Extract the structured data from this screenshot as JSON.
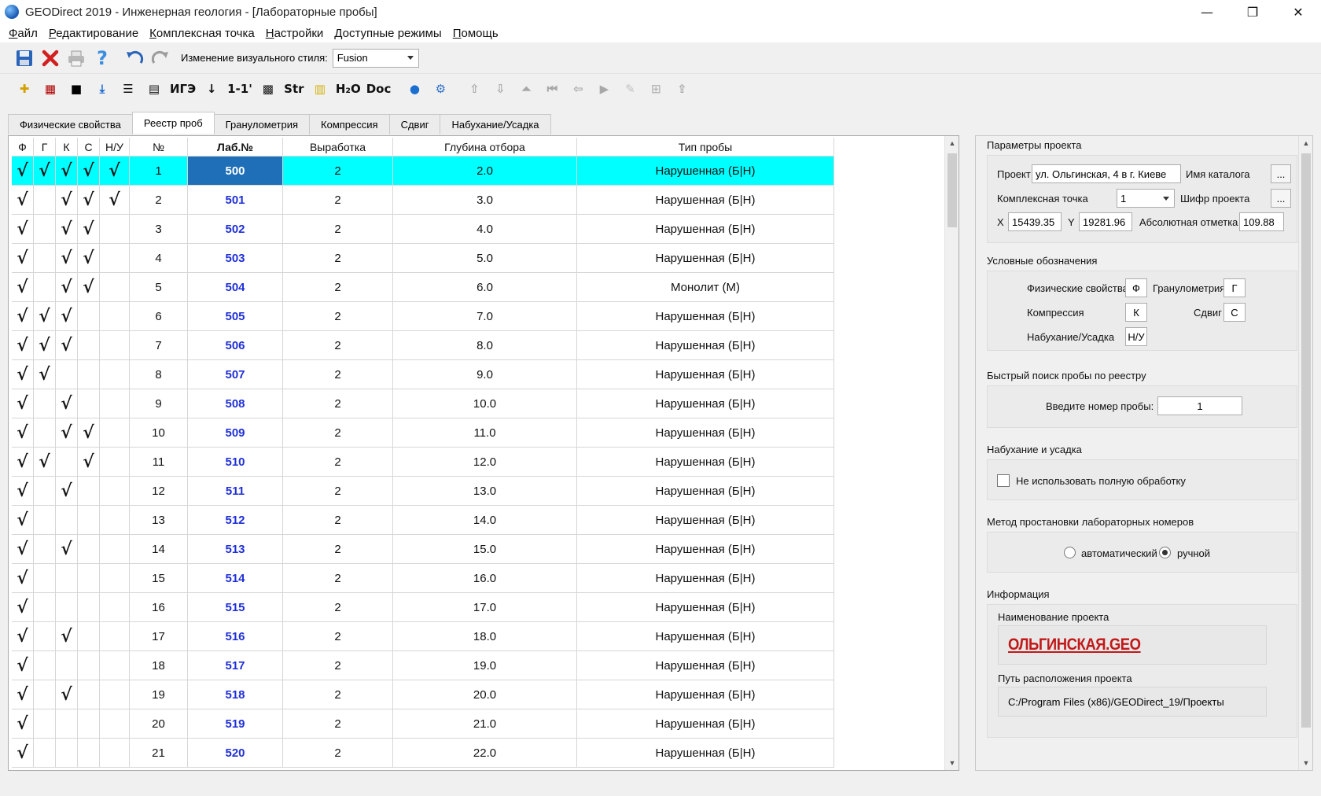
{
  "window": {
    "title": "GEODirect 2019 - Инженерная геология - [Лабораторные пробы]",
    "minimize": "—",
    "restore": "❐",
    "close": "✕"
  },
  "menu": [
    "Файл",
    "Редактирование",
    "Комплексная точка",
    "Настройки",
    "Доступные режимы",
    "Помощь"
  ],
  "toolbar1": {
    "style_label": "Изменение визуального стиля:",
    "style_value": "Fusion",
    "icons": [
      "save-icon",
      "delete-icon",
      "print-icon",
      "help-icon",
      "undo-icon",
      "redo-icon"
    ]
  },
  "toolbar2": {
    "items": [
      {
        "name": "crosshair-icon",
        "text": "✚",
        "color": "#d4a000"
      },
      {
        "name": "hatch-icon",
        "text": "▦",
        "color": "#b00000"
      },
      {
        "name": "black-square-icon",
        "text": "■",
        "color": "#000000"
      },
      {
        "name": "download-icon",
        "text": "⤓",
        "color": "#1060d0"
      },
      {
        "name": "lines-icon",
        "text": "☰",
        "color": "#111111"
      },
      {
        "name": "list-icon",
        "text": "▤",
        "color": "#111111"
      },
      {
        "name": "igz-button",
        "text": "ИГЭ",
        "color": "#111111"
      },
      {
        "name": "arrow-down-icon",
        "text": "↓",
        "color": "#111111"
      },
      {
        "name": "section-button",
        "text": "1-1'",
        "color": "#111111"
      },
      {
        "name": "grid-icon",
        "text": "▩",
        "color": "#111111"
      },
      {
        "name": "str-button",
        "text": "Str",
        "color": "#111111"
      },
      {
        "name": "ruler-icon",
        "text": "▥",
        "color": "#d4b000"
      },
      {
        "name": "h2o-button",
        "text": "H₂O",
        "color": "#111111"
      },
      {
        "name": "doc-button",
        "text": "Doc",
        "color": "#111111"
      },
      {
        "name": "globe-icon",
        "text": "●",
        "color": "#1a6fd0"
      },
      {
        "name": "settings-icon",
        "text": "⚙",
        "color": "#2a70c8"
      },
      {
        "name": "move-up-icon",
        "text": "⇧",
        "color": "#a8a8a8"
      },
      {
        "name": "move-down-icon",
        "text": "⇩",
        "color": "#a8a8a8"
      },
      {
        "name": "move-top-icon",
        "text": "⏶",
        "color": "#a8a8a8"
      },
      {
        "name": "move-first-icon",
        "text": "⏮",
        "color": "#a8a8a8"
      },
      {
        "name": "move-left-icon",
        "text": "⇦",
        "color": "#a8a8a8"
      },
      {
        "name": "play-icon",
        "text": "▶",
        "color": "#a8a8a8"
      },
      {
        "name": "pencil-icon",
        "text": "✎",
        "color": "#c0c0c0"
      },
      {
        "name": "tree-icon",
        "text": "⊞",
        "color": "#b8b8b8"
      },
      {
        "name": "upload-icon",
        "text": "⇪",
        "color": "#a8a8a8"
      }
    ]
  },
  "tabs": [
    {
      "label": "Физические свойства",
      "active": false
    },
    {
      "label": "Реестр проб",
      "active": true
    },
    {
      "label": "Гранулометрия",
      "active": false
    },
    {
      "label": "Компрессия",
      "active": false
    },
    {
      "label": "Сдвиг",
      "active": false
    },
    {
      "label": "Набухание/Усадка",
      "active": false
    }
  ],
  "table": {
    "headers": [
      "Ф",
      "Г",
      "К",
      "С",
      "Н/У",
      "№",
      "Лаб.№",
      "Выработка",
      "Глубина отбора",
      "Тип пробы"
    ],
    "check_glyph": "√",
    "rows": [
      {
        "f": true,
        "g": true,
        "k": true,
        "s": true,
        "nu": true,
        "n": "1",
        "lab": "500",
        "work": "2",
        "depth": "2.0",
        "type": "Нарушенная (Б|Н)",
        "selected": true
      },
      {
        "f": true,
        "g": false,
        "k": true,
        "s": true,
        "nu": true,
        "n": "2",
        "lab": "501",
        "work": "2",
        "depth": "3.0",
        "type": "Нарушенная (Б|Н)"
      },
      {
        "f": true,
        "g": false,
        "k": true,
        "s": true,
        "nu": false,
        "n": "3",
        "lab": "502",
        "work": "2",
        "depth": "4.0",
        "type": "Нарушенная (Б|Н)"
      },
      {
        "f": true,
        "g": false,
        "k": true,
        "s": true,
        "nu": false,
        "n": "4",
        "lab": "503",
        "work": "2",
        "depth": "5.0",
        "type": "Нарушенная (Б|Н)"
      },
      {
        "f": true,
        "g": false,
        "k": true,
        "s": true,
        "nu": false,
        "n": "5",
        "lab": "504",
        "work": "2",
        "depth": "6.0",
        "type": "Монолит (М)"
      },
      {
        "f": true,
        "g": true,
        "k": true,
        "s": false,
        "nu": false,
        "n": "6",
        "lab": "505",
        "work": "2",
        "depth": "7.0",
        "type": "Нарушенная (Б|Н)"
      },
      {
        "f": true,
        "g": true,
        "k": true,
        "s": false,
        "nu": false,
        "n": "7",
        "lab": "506",
        "work": "2",
        "depth": "8.0",
        "type": "Нарушенная (Б|Н)"
      },
      {
        "f": true,
        "g": true,
        "k": false,
        "s": false,
        "nu": false,
        "n": "8",
        "lab": "507",
        "work": "2",
        "depth": "9.0",
        "type": "Нарушенная (Б|Н)"
      },
      {
        "f": true,
        "g": false,
        "k": true,
        "s": false,
        "nu": false,
        "n": "9",
        "lab": "508",
        "work": "2",
        "depth": "10.0",
        "type": "Нарушенная (Б|Н)"
      },
      {
        "f": true,
        "g": false,
        "k": true,
        "s": true,
        "nu": false,
        "n": "10",
        "lab": "509",
        "work": "2",
        "depth": "11.0",
        "type": "Нарушенная (Б|Н)"
      },
      {
        "f": true,
        "g": true,
        "k": false,
        "s": true,
        "nu": false,
        "n": "11",
        "lab": "510",
        "work": "2",
        "depth": "12.0",
        "type": "Нарушенная (Б|Н)"
      },
      {
        "f": true,
        "g": false,
        "k": true,
        "s": false,
        "nu": false,
        "n": "12",
        "lab": "511",
        "work": "2",
        "depth": "13.0",
        "type": "Нарушенная (Б|Н)"
      },
      {
        "f": true,
        "g": false,
        "k": false,
        "s": false,
        "nu": false,
        "n": "13",
        "lab": "512",
        "work": "2",
        "depth": "14.0",
        "type": "Нарушенная (Б|Н)"
      },
      {
        "f": true,
        "g": false,
        "k": true,
        "s": false,
        "nu": false,
        "n": "14",
        "lab": "513",
        "work": "2",
        "depth": "15.0",
        "type": "Нарушенная (Б|Н)"
      },
      {
        "f": true,
        "g": false,
        "k": false,
        "s": false,
        "nu": false,
        "n": "15",
        "lab": "514",
        "work": "2",
        "depth": "16.0",
        "type": "Нарушенная (Б|Н)"
      },
      {
        "f": true,
        "g": false,
        "k": false,
        "s": false,
        "nu": false,
        "n": "16",
        "lab": "515",
        "work": "2",
        "depth": "17.0",
        "type": "Нарушенная (Б|Н)"
      },
      {
        "f": true,
        "g": false,
        "k": true,
        "s": false,
        "nu": false,
        "n": "17",
        "lab": "516",
        "work": "2",
        "depth": "18.0",
        "type": "Нарушенная (Б|Н)"
      },
      {
        "f": true,
        "g": false,
        "k": false,
        "s": false,
        "nu": false,
        "n": "18",
        "lab": "517",
        "work": "2",
        "depth": "19.0",
        "type": "Нарушенная (Б|Н)"
      },
      {
        "f": true,
        "g": false,
        "k": true,
        "s": false,
        "nu": false,
        "n": "19",
        "lab": "518",
        "work": "2",
        "depth": "20.0",
        "type": "Нарушенная (Б|Н)"
      },
      {
        "f": true,
        "g": false,
        "k": false,
        "s": false,
        "nu": false,
        "n": "20",
        "lab": "519",
        "work": "2",
        "depth": "21.0",
        "type": "Нарушенная (Б|Н)"
      },
      {
        "f": true,
        "g": false,
        "k": false,
        "s": false,
        "nu": false,
        "n": "21",
        "lab": "520",
        "work": "2",
        "depth": "22.0",
        "type": "Нарушенная (Б|Н)"
      }
    ]
  },
  "panel": {
    "project_params": {
      "title": "Параметры проекта",
      "project_label": "Проект",
      "project_value": "ул. Ольгинская, 4 в г. Киеве",
      "catalog_label": "Имя каталога",
      "catalog_button": "...",
      "point_label": "Комплексная точка",
      "point_value": "1",
      "code_label": "Шифр проекта",
      "code_button": "...",
      "x_label": "X",
      "x_value": "15439.35",
      "y_label": "Y",
      "y_value": "19281.96",
      "abs_label": "Абсолютная отметка",
      "abs_value": "109.88"
    },
    "legend": {
      "title": "Условные обозначения",
      "phys_label": "Физические свойства",
      "phys_value": "Ф",
      "gran_label": "Гранулометрия",
      "gran_value": "Г",
      "comp_label": "Компрессия",
      "comp_value": "К",
      "shear_label": "Сдвиг",
      "shear_value": "С",
      "swell_label": "Набухание/Усадка",
      "swell_value": "Н/У"
    },
    "search": {
      "title": "Быстрый поиск пробы по реестру",
      "label": "Введите номер пробы:",
      "value": "1"
    },
    "swelling": {
      "title": "Набухание и усадка",
      "checkbox_label": "Не использовать полную обработку",
      "checked": false
    },
    "method": {
      "title": "Метод простановки лабораторных номеров",
      "auto_label": "автоматический",
      "manual_label": "ручной",
      "selected": "manual"
    },
    "info": {
      "title": "Информация",
      "name_label": "Наименование проекта",
      "name_value": "ОЛЬГИНСКАЯ.GEO",
      "path_label": "Путь расположения проекта",
      "path_value": "C:/Program Files (x86)/GEODirect_19/Проекты"
    }
  }
}
